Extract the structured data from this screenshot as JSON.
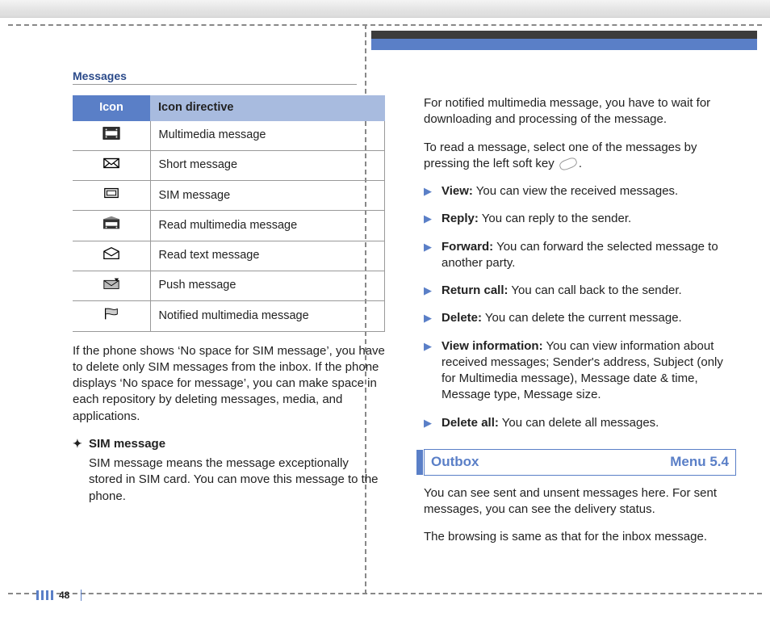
{
  "section_header": "Messages",
  "page_number": "48",
  "icon_table": {
    "header_icon": "Icon",
    "header_directive": "Icon directive",
    "rows": [
      {
        "icon": "multimedia-message-icon",
        "label": "Multimedia message"
      },
      {
        "icon": "short-message-icon",
        "label": "Short message"
      },
      {
        "icon": "sim-message-icon",
        "label": "SIM message"
      },
      {
        "icon": "read-multimedia-message-icon",
        "label": "Read multimedia message"
      },
      {
        "icon": "read-text-message-icon",
        "label": "Read text message"
      },
      {
        "icon": "push-message-icon",
        "label": "Push message"
      },
      {
        "icon": "notified-multimedia-message-icon",
        "label": "Notified multimedia message"
      }
    ]
  },
  "left": {
    "para_space": "If the phone shows ‘No space for SIM message’, you have to delete only SIM messages from the inbox. If the phone displays ‘No space for message’, you can make space in each repository by deleting messages, media, and applications.",
    "sim_heading": "SIM message",
    "sim_body": "SIM message means the message exceptionally stored in SIM card. You can move this message to the phone."
  },
  "right": {
    "para_notified": "For notified multimedia message, you have to wait for downloading and processing of the message.",
    "para_read_a": "To read a message, select one of the messages by pressing the left soft key ",
    "para_read_b": ".",
    "options": [
      {
        "term": "View:",
        "desc": " You can view the received messages."
      },
      {
        "term": "Reply:",
        "desc": " You can reply to the sender."
      },
      {
        "term": "Forward:",
        "desc": " You can forward the selected message to another party."
      },
      {
        "term": "Return call:",
        "desc": " You can call back to the sender."
      },
      {
        "term": "Delete:",
        "desc": " You can delete the current message."
      },
      {
        "term": "View information:",
        "desc": " You can view information about received messages; Sender's address, Subject (only for Multimedia message), Message date & time, Message type, Message size."
      },
      {
        "term": "Delete all:",
        "desc": " You can delete all messages."
      }
    ],
    "heading_title": "Outbox",
    "heading_menu": "Menu 5.4",
    "outbox_p1": "You can see sent and unsent messages here. For sent messages, you can see the delivery status.",
    "outbox_p2": "The browsing is same as that for the inbox message."
  }
}
